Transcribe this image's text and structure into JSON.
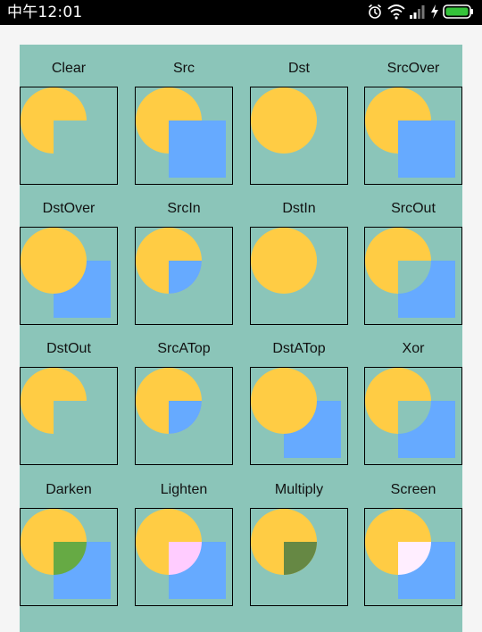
{
  "status_bar": {
    "time": "中午12:01",
    "icons": [
      "alarm-icon",
      "wifi-icon",
      "signal-icon",
      "charging-icon",
      "battery-icon"
    ],
    "battery_color": "#35c23a"
  },
  "panel": {
    "background": "#8bc5b9",
    "src_color": "#66aaff",
    "dst_color": "#ffcc44"
  },
  "modes": [
    {
      "label": "Clear",
      "mode": "clear"
    },
    {
      "label": "Src",
      "mode": "src"
    },
    {
      "label": "Dst",
      "mode": "dst"
    },
    {
      "label": "SrcOver",
      "mode": "srcover"
    },
    {
      "label": "DstOver",
      "mode": "dstover"
    },
    {
      "label": "SrcIn",
      "mode": "srcin"
    },
    {
      "label": "DstIn",
      "mode": "dstin"
    },
    {
      "label": "SrcOut",
      "mode": "srcout"
    },
    {
      "label": "DstOut",
      "mode": "dstout"
    },
    {
      "label": "SrcATop",
      "mode": "srcatop"
    },
    {
      "label": "DstATop",
      "mode": "dstatop"
    },
    {
      "label": "Xor",
      "mode": "xor"
    },
    {
      "label": "Darken",
      "mode": "darken"
    },
    {
      "label": "Lighten",
      "mode": "lighten"
    },
    {
      "label": "Multiply",
      "mode": "multiply"
    },
    {
      "label": "Screen",
      "mode": "screen"
    }
  ]
}
